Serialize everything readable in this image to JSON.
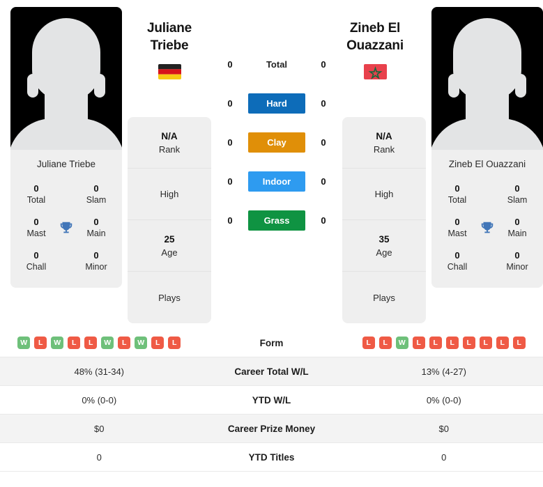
{
  "players": {
    "left": {
      "name_line1": "Juliane",
      "name_line2": "Triebe",
      "full_name": "Juliane Triebe",
      "country": "Germany",
      "flag_icon": "flag-germany-icon",
      "rank_value": "N/A",
      "rank_label": "Rank",
      "high_label": "High",
      "age_value": "25",
      "age_label": "Age",
      "plays_label": "Plays",
      "titles": {
        "total_value": "0",
        "total_label": "Total",
        "slam_value": "0",
        "slam_label": "Slam",
        "mast_value": "0",
        "mast_label": "Mast",
        "main_value": "0",
        "main_label": "Main",
        "chall_value": "0",
        "chall_label": "Chall",
        "minor_value": "0",
        "minor_label": "Minor"
      },
      "surface_counts": {
        "total": "0",
        "hard": "0",
        "clay": "0",
        "indoor": "0",
        "grass": "0"
      },
      "form": [
        "W",
        "L",
        "W",
        "L",
        "L",
        "W",
        "L",
        "W",
        "L",
        "L"
      ],
      "career_total_wl": "48% (31-34)",
      "ytd_wl": "0% (0-0)",
      "career_prize_money": "$0",
      "ytd_titles": "0"
    },
    "right": {
      "name_line1": "Zineb El",
      "name_line2": "Ouazzani",
      "full_name": "Zineb El Ouazzani",
      "country": "Morocco",
      "flag_icon": "flag-morocco-icon",
      "rank_value": "N/A",
      "rank_label": "Rank",
      "high_label": "High",
      "age_value": "35",
      "age_label": "Age",
      "plays_label": "Plays",
      "titles": {
        "total_value": "0",
        "total_label": "Total",
        "slam_value": "0",
        "slam_label": "Slam",
        "mast_value": "0",
        "mast_label": "Mast",
        "main_value": "0",
        "main_label": "Main",
        "chall_value": "0",
        "chall_label": "Chall",
        "minor_value": "0",
        "minor_label": "Minor"
      },
      "surface_counts": {
        "total": "0",
        "hard": "0",
        "clay": "0",
        "indoor": "0",
        "grass": "0"
      },
      "form": [
        "L",
        "L",
        "W",
        "L",
        "L",
        "L",
        "L",
        "L",
        "L",
        "L"
      ],
      "career_total_wl": "13% (4-27)",
      "ytd_wl": "0% (0-0)",
      "career_prize_money": "$0",
      "ytd_titles": "0"
    }
  },
  "surfaces": [
    {
      "label": "Total",
      "color": "transparent",
      "text_color": "#222222"
    },
    {
      "label": "Hard",
      "color": "#0d6cb9",
      "text_color": "#ffffff"
    },
    {
      "label": "Clay",
      "color": "#e08f08",
      "text_color": "#ffffff"
    },
    {
      "label": "Indoor",
      "color": "#2e9bf0",
      "text_color": "#ffffff"
    },
    {
      "label": "Grass",
      "color": "#0f9342",
      "text_color": "#ffffff"
    }
  ],
  "table_labels": {
    "form": "Form",
    "career_total_wl": "Career Total W/L",
    "ytd_wl": "YTD W/L",
    "career_prize_money": "Career Prize Money",
    "ytd_titles": "YTD Titles"
  },
  "colors": {
    "win_badge": "#6ec07a",
    "loss_badge": "#ef5a45",
    "trophy": "#4176b8",
    "card_bg": "#efefef",
    "row_alt_bg": "#f3f3f3"
  }
}
